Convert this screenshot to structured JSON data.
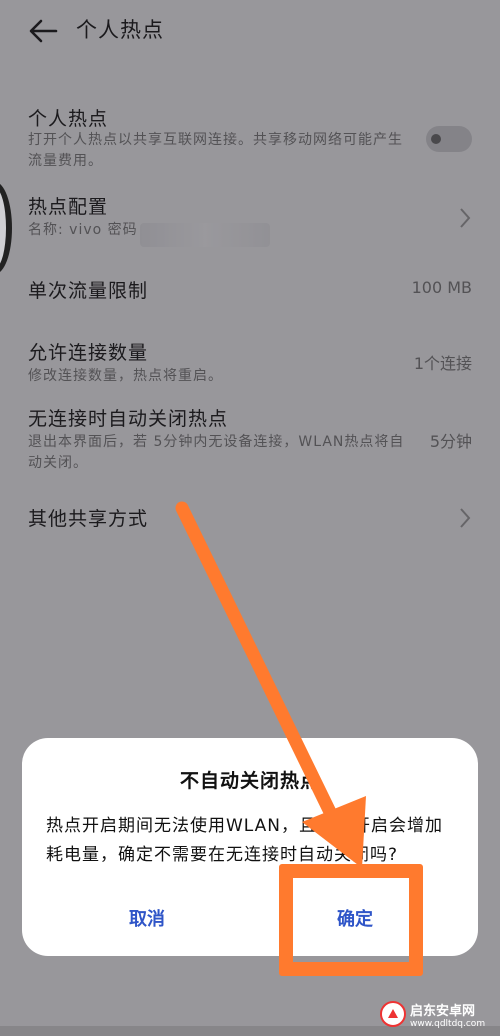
{
  "header": {
    "title": "个人热点"
  },
  "rows": {
    "hotspot": {
      "title": "个人热点",
      "subtitle": "打开个人热点以共享互联网连接。共享移动网络可能产生流量费用。"
    },
    "config": {
      "title": "热点配置",
      "subtitle": "名称: vivo  密码"
    },
    "limit": {
      "title": "单次流量限制",
      "value": "100 MB"
    },
    "connections": {
      "title": "允许连接数量",
      "subtitle": "修改连接数量，热点将重启。",
      "value": "1个连接"
    },
    "autooff": {
      "title": "无连接时自动关闭热点",
      "subtitle": "退出本界面后，若 5分钟内无设备连接，WLAN热点将自动关闭。",
      "value": "5分钟"
    },
    "other": {
      "title": "其他共享方式"
    }
  },
  "dialog": {
    "title": "不自动关闭热点",
    "message": "热点开启期间无法使用WLAN，且持续开启会增加耗电量，确定不需要在无连接时自动关闭吗?",
    "cancel_label": "取消",
    "ok_label": "确定"
  },
  "watermark": {
    "name": "启东安卓网",
    "url": "www.qdltdq.com"
  },
  "colors": {
    "accent": "#2f55c8",
    "annotation": "#ff7a2e"
  },
  "icons": {
    "back": "back-arrow-icon",
    "chevron": "chevron-right-icon"
  }
}
